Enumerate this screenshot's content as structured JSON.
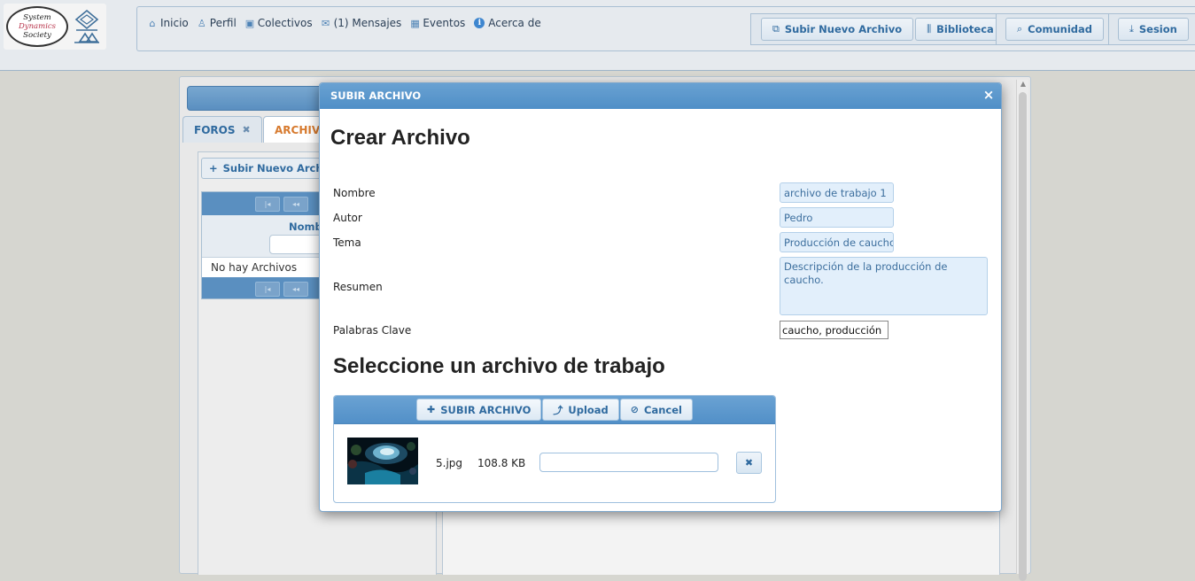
{
  "logo": {
    "line1": "System",
    "line2": "Dynamics",
    "line3": "Society",
    "icon": "society-emblem-icon"
  },
  "nav": {
    "items": [
      {
        "label": "Inicio",
        "icon": "home-icon"
      },
      {
        "label": "Perfil",
        "icon": "user-icon"
      },
      {
        "label": "Colectivos",
        "icon": "group-card-icon"
      },
      {
        "label": "(1) Mensajes",
        "icon": "mail-icon"
      },
      {
        "label": "Eventos",
        "icon": "calendar-icon"
      },
      {
        "label": "Acerca de",
        "icon": "info-icon"
      }
    ]
  },
  "header_buttons": {
    "subir": "Subir Nuevo Archivo",
    "biblioteca": "Biblioteca",
    "comunidad": "Comunidad",
    "sesion": "Sesion"
  },
  "background": {
    "tabs": [
      {
        "label": "FOROS"
      },
      {
        "label": "ARCHIVOS"
      }
    ],
    "subir_button": "Subir Nuevo Archivo",
    "column_header": "Nombre",
    "empty_text": "No hay Archivos"
  },
  "dialog": {
    "title": "SUBIR ARCHIVO",
    "heading": "Crear Archivo",
    "fields": {
      "nombre": {
        "label": "Nombre",
        "value": "archivo de trabajo 1"
      },
      "autor": {
        "label": "Autor",
        "value": "Pedro"
      },
      "tema": {
        "label": "Tema",
        "value": "Producción de caucho"
      },
      "resumen": {
        "label": "Resumen",
        "value": "Descripción de la producción de caucho."
      },
      "palabras": {
        "label": "Palabras Clave",
        "value": "caucho, producción"
      }
    },
    "section_heading": "Seleccione un archivo de trabajo",
    "uploader": {
      "buttons": {
        "subir": "SUBIR ARCHIVO",
        "upload": "Upload",
        "cancel": "Cancel"
      },
      "file": {
        "name": "5.jpg",
        "size": "108.8 KB",
        "description": ""
      }
    }
  },
  "colors": {
    "accent": "#5290c8",
    "active_tab": "#d77a2e",
    "field_bg": "#e2effb"
  }
}
